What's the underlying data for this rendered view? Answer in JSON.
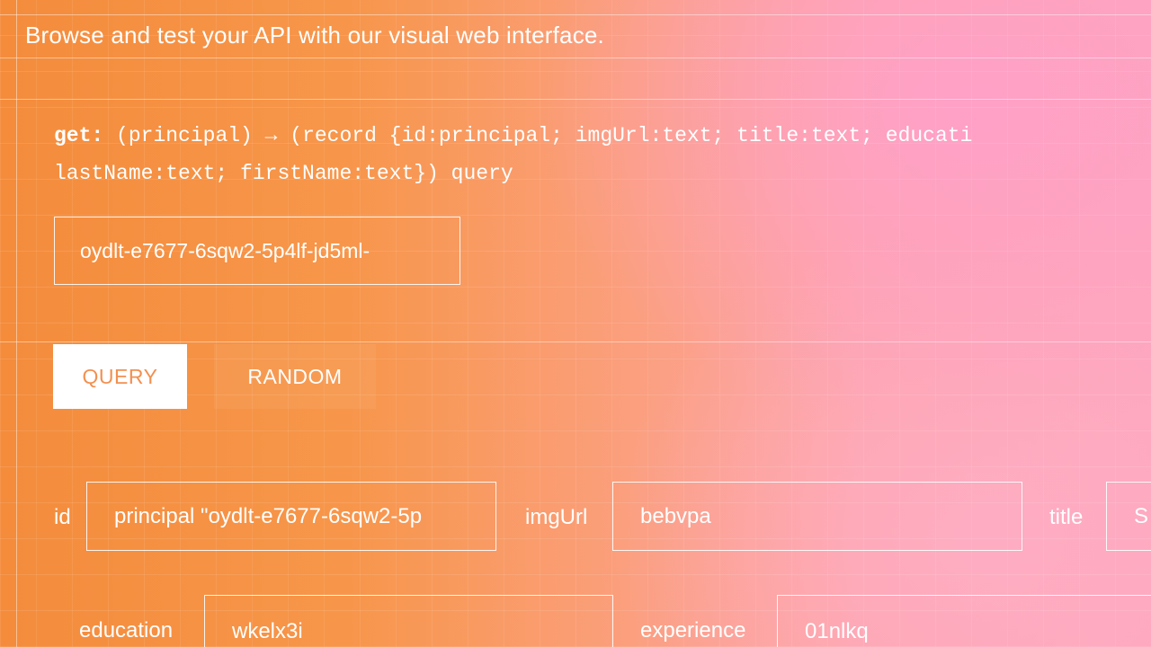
{
  "header": {
    "subtitle": "Browse and test your API with our visual web interface."
  },
  "method": {
    "name": "get:",
    "signature_line1": "(principal) → (record {id:principal; imgUrl:text; title:text; educati",
    "signature_line2": "lastName:text; firstName:text}) query",
    "principal_input_value": "oydlt-e7677-6sqw2-5p4lf-jd5ml-"
  },
  "actions": {
    "query_label": "QUERY",
    "random_label": "RANDOM"
  },
  "record_fields": [
    {
      "label": "id",
      "value": "principal \"oydlt-e7677-6sqw2-5p"
    },
    {
      "label": "imgUrl",
      "value": "bebvpa"
    },
    {
      "label": "title",
      "value": "S"
    },
    {
      "label": "education",
      "value": "wkelx3i"
    },
    {
      "label": "experience",
      "value": "01nlkq"
    }
  ],
  "colors": {
    "background_left": "#f48c3c",
    "background_right": "#fea6bc",
    "query_button_text": "#f39050"
  }
}
